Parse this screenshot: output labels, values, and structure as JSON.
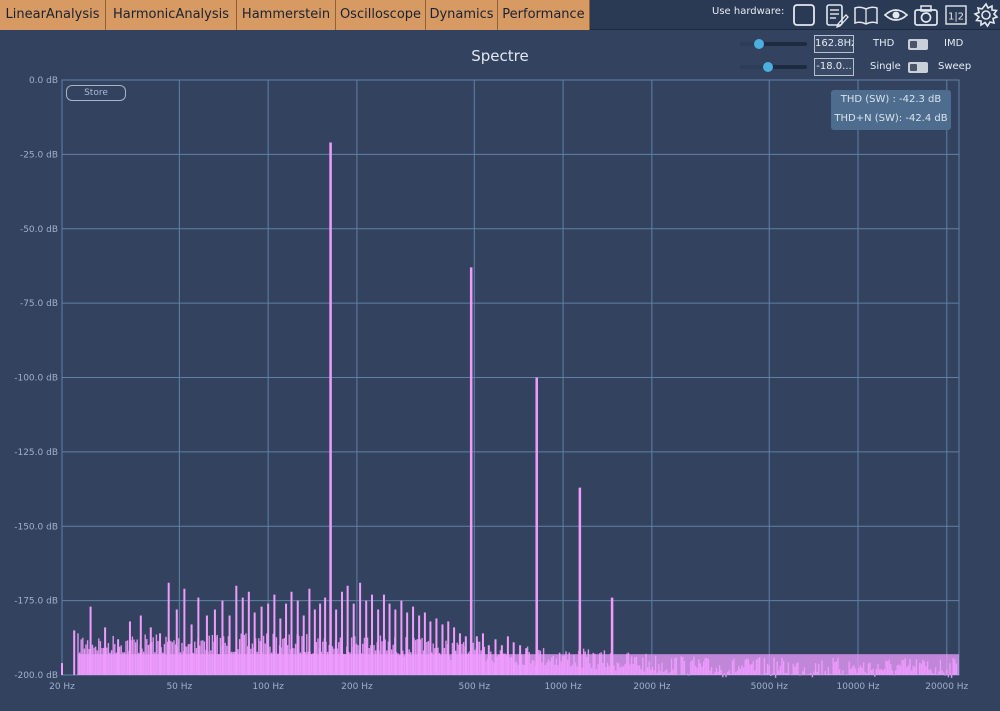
{
  "tabs": [
    {
      "label": "LinearAnalysis"
    },
    {
      "label": "HarmonicAnalysis"
    },
    {
      "label": "Hammerstein"
    },
    {
      "label": "Oscilloscope"
    },
    {
      "label": "Dynamics"
    },
    {
      "label": "Performance"
    }
  ],
  "hardware": {
    "label": "Use hardware:",
    "icons": [
      "checkbox-icon",
      "notes-icon",
      "book-icon",
      "eye-icon",
      "camera-icon",
      "split-view-icon",
      "gear-icon"
    ],
    "split_view_text": "1|2"
  },
  "controls": {
    "frequency_value": "162.8Hz",
    "frequency_slider_level": 0.28,
    "level_value": "-18.0...",
    "level_slider_level": 0.42,
    "mode_left": "THD",
    "mode_right": "IMD",
    "run_left": "Single",
    "run_right": "Sweep"
  },
  "store_label": "Store",
  "readout": {
    "thd": "THD (SW) : -42.3 dB",
    "thdn": "THD+N (SW): -42.4 dB"
  },
  "colors": {
    "background": "#33435f",
    "grid": "#5f82a3",
    "spectrum": "#f09cff",
    "tab": "#d69a62",
    "knob": "#4bb0e0"
  },
  "chart_data": {
    "type": "bar",
    "title": "Spectre",
    "x_scale": "log",
    "xlim": [
      20,
      22000
    ],
    "ylim": [
      -200,
      0
    ],
    "grid": true,
    "x_ticks": [
      {
        "v": 20,
        "label": "20 Hz"
      },
      {
        "v": 50,
        "label": "50 Hz"
      },
      {
        "v": 100,
        "label": "100 Hz"
      },
      {
        "v": 200,
        "label": "200 Hz"
      },
      {
        "v": 500,
        "label": "500 Hz"
      },
      {
        "v": 1000,
        "label": "1000 Hz"
      },
      {
        "v": 2000,
        "label": "2000 Hz"
      },
      {
        "v": 5000,
        "label": "5000 Hz"
      },
      {
        "v": 10000,
        "label": "10000 Hz"
      },
      {
        "v": 20000,
        "label": "20000 Hz"
      }
    ],
    "y_ticks": [
      {
        "v": 0,
        "label": "0.0 dB"
      },
      {
        "v": -25,
        "label": "-25.0 dB"
      },
      {
        "v": -50,
        "label": "-50.0 dB"
      },
      {
        "v": -75,
        "label": "-75.0 dB"
      },
      {
        "v": -100,
        "label": "-100.0 dB"
      },
      {
        "v": -125,
        "label": "-125.0 dB"
      },
      {
        "v": -150,
        "label": "-150.0 dB"
      },
      {
        "v": -175,
        "label": "-175.0 dB"
      },
      {
        "v": -200,
        "label": "-200.0 dB"
      }
    ],
    "peaks": [
      {
        "f": 162.8,
        "db": -21
      },
      {
        "f": 488,
        "db": -63
      },
      {
        "f": 814,
        "db": -100
      },
      {
        "f": 1140,
        "db": -137
      },
      {
        "f": 1466,
        "db": -174
      }
    ],
    "subharmonic_lines": [
      {
        "f": 20,
        "db": -196
      },
      {
        "f": 22,
        "db": -185
      },
      {
        "f": 25,
        "db": -177
      },
      {
        "f": 28,
        "db": -184
      },
      {
        "f": 31,
        "db": -188
      },
      {
        "f": 34,
        "db": -182
      },
      {
        "f": 37,
        "db": -180
      },
      {
        "f": 40,
        "db": -184
      },
      {
        "f": 43,
        "db": -186
      },
      {
        "f": 46,
        "db": -169
      },
      {
        "f": 49,
        "db": -178
      },
      {
        "f": 52,
        "db": -171
      },
      {
        "f": 55,
        "db": -183
      },
      {
        "f": 58,
        "db": -174
      },
      {
        "f": 62,
        "db": -180
      },
      {
        "f": 66,
        "db": -178
      },
      {
        "f": 70,
        "db": -175
      },
      {
        "f": 74,
        "db": -180
      },
      {
        "f": 78,
        "db": -170
      },
      {
        "f": 82,
        "db": -174
      },
      {
        "f": 86,
        "db": -172
      },
      {
        "f": 90,
        "db": -179
      },
      {
        "f": 95,
        "db": -177
      },
      {
        "f": 100,
        "db": -176
      },
      {
        "f": 105,
        "db": -173
      },
      {
        "f": 110,
        "db": -181
      },
      {
        "f": 115,
        "db": -176
      },
      {
        "f": 120,
        "db": -172
      },
      {
        "f": 126,
        "db": -175
      },
      {
        "f": 132,
        "db": -180
      },
      {
        "f": 138,
        "db": -171
      },
      {
        "f": 144,
        "db": -178
      },
      {
        "f": 150,
        "db": -176
      },
      {
        "f": 156,
        "db": -174
      },
      {
        "f": 170,
        "db": -178
      },
      {
        "f": 178,
        "db": -172
      },
      {
        "f": 186,
        "db": -170
      },
      {
        "f": 195,
        "db": -176
      },
      {
        "f": 205,
        "db": -169
      },
      {
        "f": 215,
        "db": -175
      },
      {
        "f": 225,
        "db": -173
      },
      {
        "f": 236,
        "db": -178
      },
      {
        "f": 247,
        "db": -173
      },
      {
        "f": 258,
        "db": -176
      },
      {
        "f": 270,
        "db": -178
      },
      {
        "f": 283,
        "db": -175
      },
      {
        "f": 296,
        "db": -179
      },
      {
        "f": 310,
        "db": -177
      },
      {
        "f": 325,
        "db": -180
      },
      {
        "f": 340,
        "db": -179
      },
      {
        "f": 355,
        "db": -182
      },
      {
        "f": 372,
        "db": -181
      },
      {
        "f": 390,
        "db": -183
      },
      {
        "f": 408,
        "db": -182
      },
      {
        "f": 427,
        "db": -184
      },
      {
        "f": 447,
        "db": -186
      },
      {
        "f": 468,
        "db": -187
      },
      {
        "f": 510,
        "db": -187
      },
      {
        "f": 535,
        "db": -186
      },
      {
        "f": 560,
        "db": -190
      },
      {
        "f": 590,
        "db": -188
      },
      {
        "f": 620,
        "db": -190
      },
      {
        "f": 650,
        "db": -187
      },
      {
        "f": 680,
        "db": -189
      },
      {
        "f": 715,
        "db": -190
      },
      {
        "f": 750,
        "db": -191
      }
    ],
    "noise_floor_db": [
      -200,
      -186
    ]
  }
}
